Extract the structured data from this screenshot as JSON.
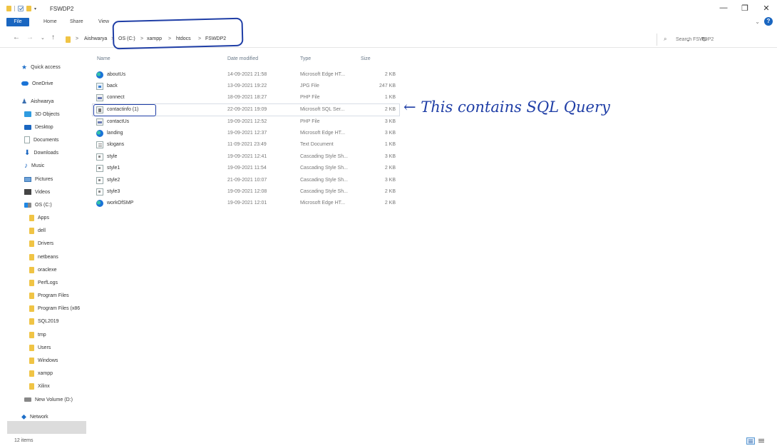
{
  "window": {
    "title": "FSWDP2"
  },
  "window_controls": {
    "minimize": "—",
    "restore": "❐",
    "close": "✕"
  },
  "ribbon": {
    "tabs": [
      "File",
      "Home",
      "Share",
      "View"
    ],
    "expand": "⌄",
    "help": "?"
  },
  "nav": {
    "back": "←",
    "forward": "→",
    "recent": "⌄",
    "up": "↑"
  },
  "address": {
    "separator": ">",
    "crumbs": [
      "Aishwarya",
      "OS (C:)",
      "xampp",
      "htdocs",
      "FSWDP2"
    ],
    "dropdown": "⌄",
    "refresh": "↻"
  },
  "search": {
    "placeholder": "Search FSWDP2",
    "value": ""
  },
  "nav_pane": {
    "items": [
      {
        "label": "Quick access",
        "icon": "star-icon"
      },
      {
        "label": "OneDrive",
        "icon": "cloud-icon"
      },
      {
        "label": "Aishwarya",
        "icon": "person-icon"
      },
      {
        "label": "3D Objects",
        "icon": "cube-icon"
      },
      {
        "label": "Desktop",
        "icon": "desktop-icon"
      },
      {
        "label": "Documents",
        "icon": "documents-icon"
      },
      {
        "label": "Downloads",
        "icon": "download-icon"
      },
      {
        "label": "Music",
        "icon": "music-icon"
      },
      {
        "label": "Pictures",
        "icon": "pictures-icon"
      },
      {
        "label": "Videos",
        "icon": "videos-icon"
      },
      {
        "label": "OS (C:)",
        "icon": "drive-icon"
      },
      {
        "label": "Apps",
        "icon": "folder-icon"
      },
      {
        "label": "dell",
        "icon": "folder-icon"
      },
      {
        "label": "Drivers",
        "icon": "folder-icon"
      },
      {
        "label": "netbeans",
        "icon": "folder-icon"
      },
      {
        "label": "oraclexe",
        "icon": "folder-icon"
      },
      {
        "label": "PerfLogs",
        "icon": "folder-icon"
      },
      {
        "label": "Program Files",
        "icon": "folder-icon"
      },
      {
        "label": "Program Files (x86",
        "icon": "folder-icon"
      },
      {
        "label": "SQL2019",
        "icon": "folder-icon"
      },
      {
        "label": "tmp",
        "icon": "folder-icon"
      },
      {
        "label": "Users",
        "icon": "folder-icon"
      },
      {
        "label": "Windows",
        "icon": "folder-icon"
      },
      {
        "label": "xampp",
        "icon": "folder-icon",
        "selected": true
      },
      {
        "label": "Xilinx",
        "icon": "folder-icon"
      },
      {
        "label": "New Volume (D:)",
        "icon": "drive-icon"
      },
      {
        "label": "Network",
        "icon": "network-icon"
      }
    ]
  },
  "columns": {
    "name": "Name",
    "date": "Date modified",
    "type": "Type",
    "size": "Size"
  },
  "files": [
    {
      "name": "aboutUs",
      "date": "14-09-2021 21:58",
      "type": "Microsoft Edge HT...",
      "size": "2 KB",
      "icon": "edge-icon"
    },
    {
      "name": "back",
      "date": "13-09-2021 19:22",
      "type": "JPG File",
      "size": "247 KB",
      "icon": "jpg-file-icon"
    },
    {
      "name": "connect",
      "date": "18-09-2021 18:27",
      "type": "PHP File",
      "size": "1 KB",
      "icon": "php-file-icon"
    },
    {
      "name": "contactinfo (1)",
      "date": "22-09-2021 19:09",
      "type": "Microsoft SQL Ser...",
      "size": "2 KB",
      "icon": "sql-file-icon"
    },
    {
      "name": "contactUs",
      "date": "19-09-2021 12:52",
      "type": "PHP File",
      "size": "3 KB",
      "icon": "php-file-icon"
    },
    {
      "name": "landing",
      "date": "19-09-2021 12:37",
      "type": "Microsoft Edge HT...",
      "size": "3 KB",
      "icon": "edge-icon"
    },
    {
      "name": "slogans",
      "date": "11-09-2021 23:49",
      "type": "Text Document",
      "size": "1 KB",
      "icon": "text-file-icon"
    },
    {
      "name": "style",
      "date": "19-09-2021 12:41",
      "type": "Cascading Style Sh...",
      "size": "3 KB",
      "icon": "css-file-icon"
    },
    {
      "name": "style1",
      "date": "19-09-2021 11:54",
      "type": "Cascading Style Sh...",
      "size": "2 KB",
      "icon": "css-file-icon"
    },
    {
      "name": "style2",
      "date": "21-09-2021 10:07",
      "type": "Cascading Style Sh...",
      "size": "3 KB",
      "icon": "css-file-icon"
    },
    {
      "name": "style3",
      "date": "19-09-2021 12:08",
      "type": "Cascading Style Sh...",
      "size": "2 KB",
      "icon": "css-file-icon"
    },
    {
      "name": "workOfSMP",
      "date": "19-09-2021 12:01",
      "type": "Microsoft Edge HT...",
      "size": "2 KB",
      "icon": "edge-icon"
    }
  ],
  "annotation": {
    "text": "← This contains SQL Query",
    "color": "#1f3ea6"
  },
  "status": {
    "item_count": "12 items"
  },
  "colors": {
    "accent": "#1a66c0",
    "folder": "#f0c445",
    "selection": "#dcdcdc"
  }
}
